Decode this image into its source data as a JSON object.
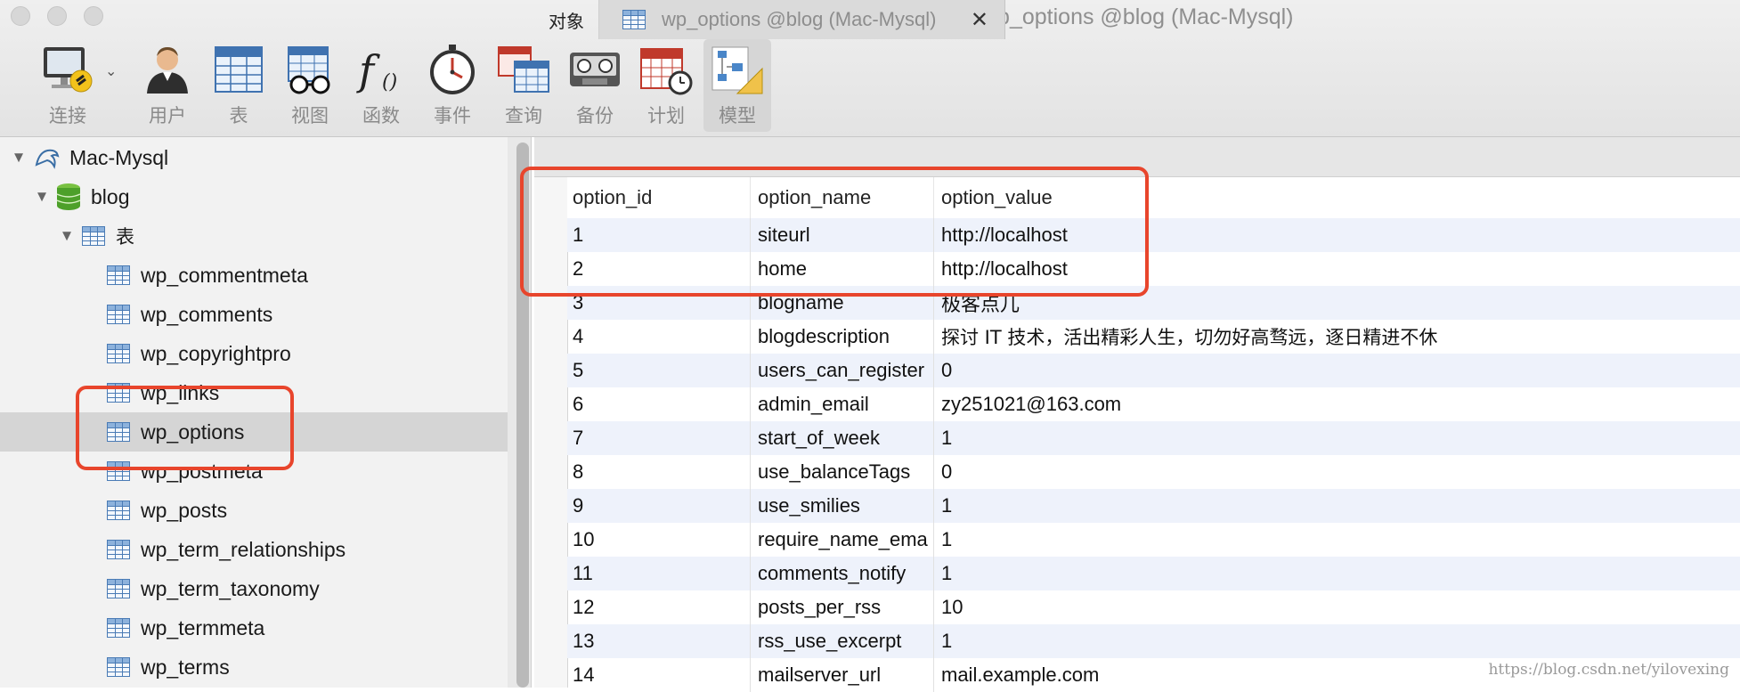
{
  "window": {
    "title": "wp_options @blog (Mac-Mysql)"
  },
  "toolbar": {
    "items": [
      {
        "label": "连接",
        "icon": "connection-icon"
      },
      {
        "label": "用户",
        "icon": "user-icon"
      },
      {
        "label": "表",
        "icon": "table-icon"
      },
      {
        "label": "视图",
        "icon": "view-icon"
      },
      {
        "label": "函数",
        "icon": "function-icon"
      },
      {
        "label": "事件",
        "icon": "event-icon"
      },
      {
        "label": "查询",
        "icon": "query-icon"
      },
      {
        "label": "备份",
        "icon": "backup-icon"
      },
      {
        "label": "计划",
        "icon": "schedule-icon"
      },
      {
        "label": "模型",
        "icon": "model-icon"
      }
    ],
    "active": "模型"
  },
  "sidebar": {
    "connection": "Mac-Mysql",
    "database": "blog",
    "group": "表",
    "tables": [
      "wp_commentmeta",
      "wp_comments",
      "wp_copyrightpro",
      "wp_links",
      "wp_options",
      "wp_postmeta",
      "wp_posts",
      "wp_term_relationships",
      "wp_term_taxonomy",
      "wp_termmeta",
      "wp_terms"
    ],
    "selected": "wp_options"
  },
  "tabs": {
    "objects": "对象",
    "active": "wp_options @blog (Mac-Mysql)"
  },
  "grid": {
    "columns": [
      "option_id",
      "option_name",
      "option_value"
    ],
    "rows": [
      [
        "1",
        "siteurl",
        "http://localhost"
      ],
      [
        "2",
        "home",
        "http://localhost"
      ],
      [
        "3",
        "blogname",
        "极客点儿"
      ],
      [
        "4",
        "blogdescription",
        "探讨 IT 技术，活出精彩人生，切勿好高骛远，逐日精进不休"
      ],
      [
        "5",
        "users_can_register",
        "0"
      ],
      [
        "6",
        "admin_email",
        "zy251021@163.com"
      ],
      [
        "7",
        "start_of_week",
        "1"
      ],
      [
        "8",
        "use_balanceTags",
        "0"
      ],
      [
        "9",
        "use_smilies",
        "1"
      ],
      [
        "10",
        "require_name_ema",
        "1"
      ],
      [
        "11",
        "comments_notify",
        "1"
      ],
      [
        "12",
        "posts_per_rss",
        "10"
      ],
      [
        "13",
        "rss_use_excerpt",
        "1"
      ],
      [
        "14",
        "mailserver_url",
        "mail.example.com"
      ]
    ]
  },
  "watermark": "https://blog.csdn.net/yilovexing",
  "colors": {
    "highlight": "#e8452c",
    "alt_row": "#eef2fb",
    "selected_row": "#d5d5d5"
  }
}
